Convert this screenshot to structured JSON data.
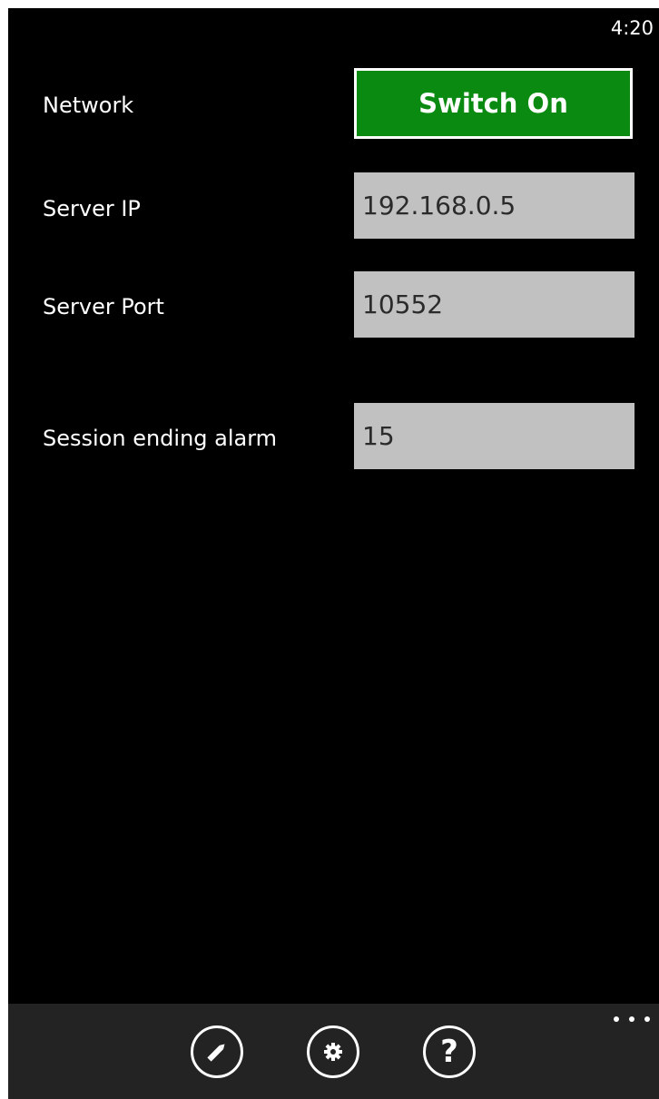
{
  "status_bar": {
    "time": "4:20"
  },
  "settings": {
    "network": {
      "label": "Network",
      "button_label": "Switch On",
      "button_color": "#0a8a10"
    },
    "server_ip": {
      "label": "Server IP",
      "value": "192.168.0.5"
    },
    "server_port": {
      "label": "Server Port",
      "value": "10552"
    },
    "session_alarm": {
      "label": "Session ending alarm",
      "value": "15"
    }
  },
  "app_bar": {
    "buttons": [
      {
        "icon": "pencil-icon"
      },
      {
        "icon": "gear-icon"
      },
      {
        "icon": "question-icon",
        "glyph": "?"
      }
    ],
    "more": "more-icon"
  }
}
